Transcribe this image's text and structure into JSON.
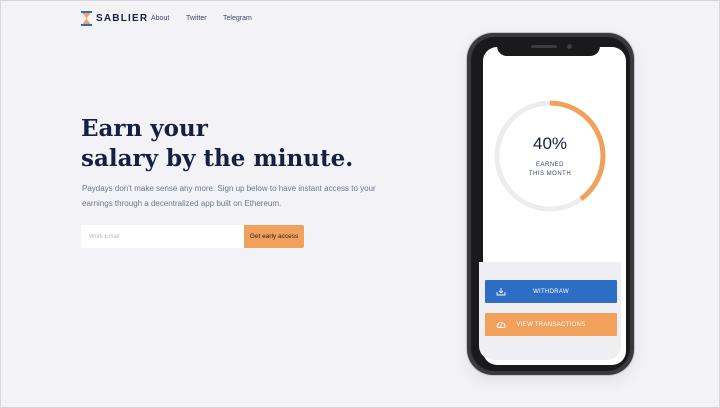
{
  "brand": {
    "name": "SABLIER",
    "accent": "#f2a15c",
    "blue": "#2c6ec4",
    "navy": "#162040"
  },
  "nav": {
    "items": [
      "About",
      "Twitter",
      "Telegram"
    ]
  },
  "hero": {
    "title_line1": "Earn your",
    "title_line2": "salary by the minute.",
    "subtitle": "Paydays don't make sense any more. Sign up below to have instant access to your earnings through a decentralized app built on Ethereum."
  },
  "signup": {
    "email_placeholder": "Work Email",
    "button_label": "Get early access"
  },
  "phone_screen": {
    "progress_percent": 40,
    "progress_label": "40%",
    "earned_line1": "EARNED",
    "earned_line2": "THIS MONTH",
    "withdraw_label": "WITHDRAW",
    "withdraw_icon": "withdraw-icon",
    "view_label": "VIEW TRANSACTIONS",
    "view_icon": "cloud-icon"
  }
}
